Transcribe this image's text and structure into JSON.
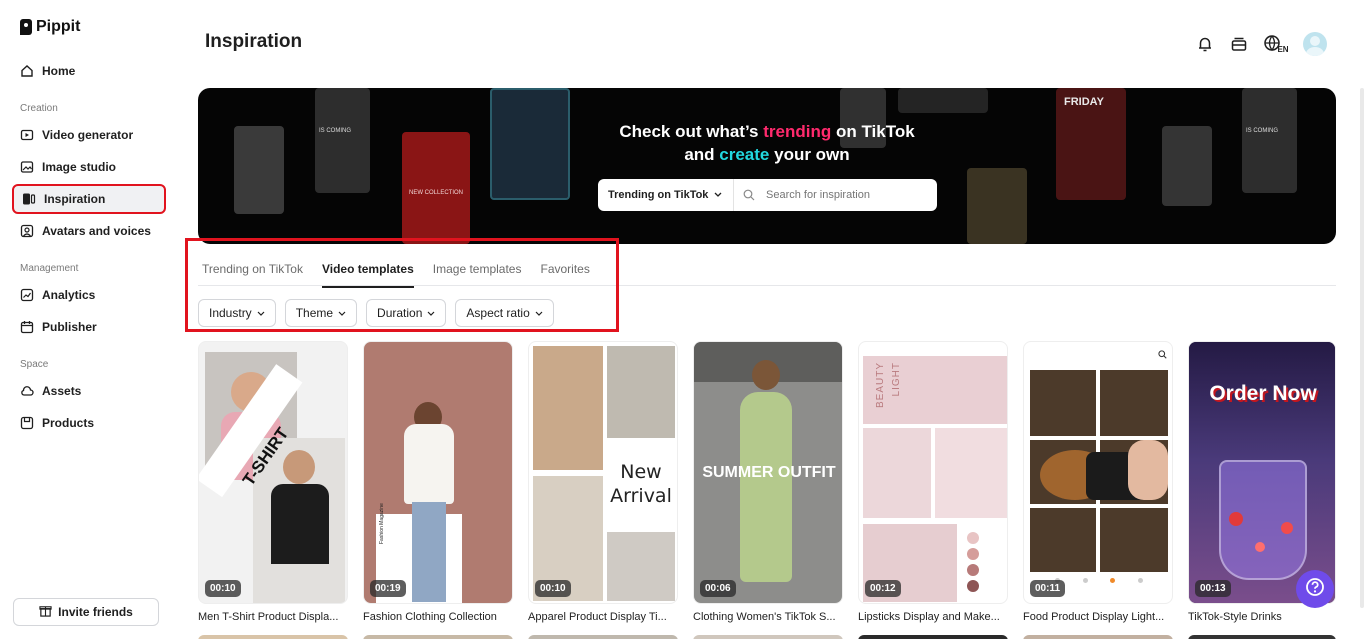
{
  "app": {
    "name": "Pippit"
  },
  "sidebar": {
    "home": "Home",
    "sections": {
      "creation": "Creation",
      "management": "Management",
      "space": "Space"
    },
    "items": {
      "video_generator": "Video generator",
      "image_studio": "Image studio",
      "inspiration": "Inspiration",
      "avatars_voices": "Avatars and voices",
      "analytics": "Analytics",
      "publisher": "Publisher",
      "assets": "Assets",
      "products": "Products"
    },
    "invite": "Invite friends",
    "active_item": "Inspiration"
  },
  "header": {
    "title": "Inspiration",
    "language": "EN",
    "icons": [
      "bell-icon",
      "inbox-icon",
      "globe-icon",
      "avatar"
    ]
  },
  "banner": {
    "line1_a": "Check out what’s ",
    "line1_b": "trending",
    "line1_c": " on TikTok",
    "line2_a": "and ",
    "line2_b": "create",
    "line2_c": " your own",
    "deco_texts": {
      "coming1": "IS COMING",
      "friday": "FRIDAY",
      "coming2": "IS COMING",
      "new_collection": "NEW COLLECTION"
    },
    "search": {
      "selected": "Trending on TikTok",
      "placeholder": "Search for inspiration"
    },
    "colors": {
      "pink": "#ff2a6d",
      "cyan": "#22d8df"
    }
  },
  "tabs": [
    "Trending on TikTok",
    "Video templates",
    "Image templates",
    "Favorites"
  ],
  "active_tab": "Video templates",
  "filters": [
    "Industry",
    "Theme",
    "Duration",
    "Aspect ratio"
  ],
  "cards": [
    {
      "title": "Men T-Shirt Product Displa...",
      "duration": "00:10",
      "overlay": "T-SHIRT"
    },
    {
      "title": "Fashion Clothing Collection",
      "duration": "00:19",
      "overlay": "Fashion Magazine"
    },
    {
      "title": "Apparel Product Display Ti...",
      "duration": "00:10",
      "overlay_a": "New",
      "overlay_b": "Arrival"
    },
    {
      "title": "Clothing Women's TikTok S...",
      "duration": "00:06",
      "overlay": "SUMMER OUTFIT"
    },
    {
      "title": "Lipsticks Display and Make...",
      "duration": "00:12",
      "overlay_a": "BEAUTY",
      "overlay_b": "LIGHT"
    },
    {
      "title": "Food Product Display Light...",
      "duration": "00:11"
    },
    {
      "title": "TikTok-Style Drinks",
      "duration": "00:13",
      "overlay": "Order Now"
    }
  ],
  "accent_colors": {
    "highlight": "#e1131e",
    "help": "#6f4bea"
  }
}
